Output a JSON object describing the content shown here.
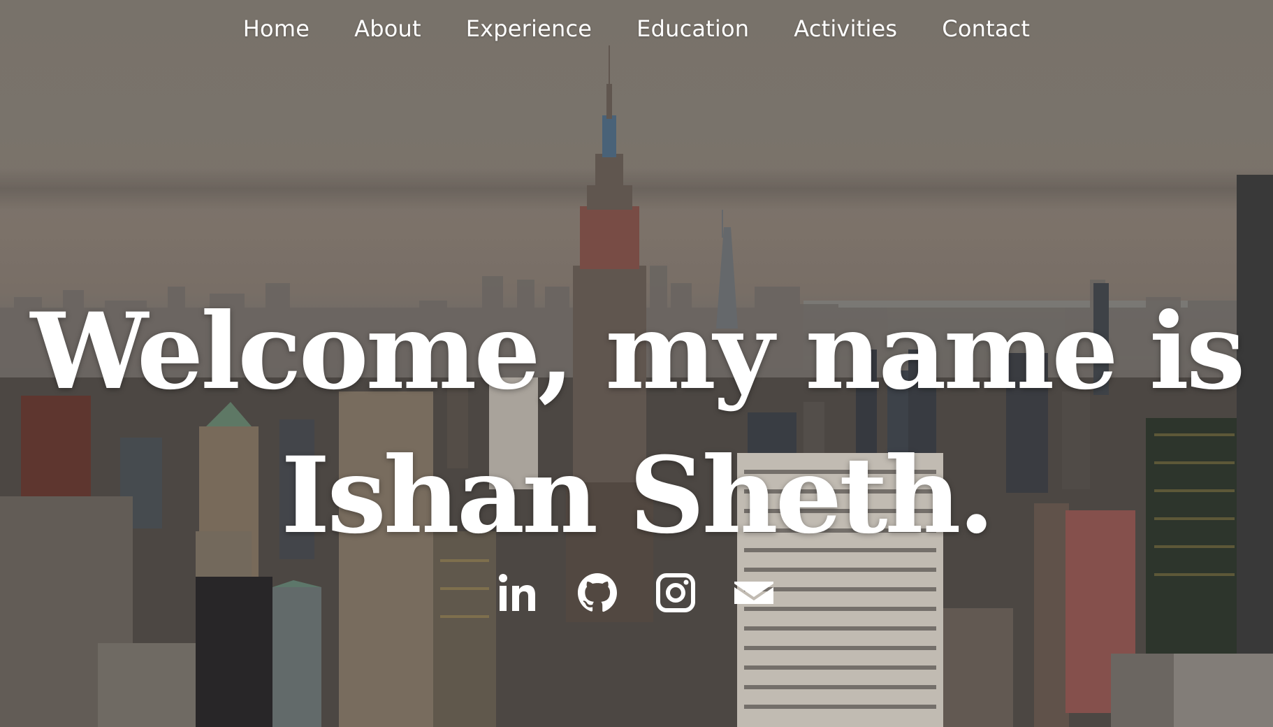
{
  "nav": {
    "items": [
      {
        "label": "Home"
      },
      {
        "label": "About"
      },
      {
        "label": "Experience"
      },
      {
        "label": "Education"
      },
      {
        "label": "Activities"
      },
      {
        "label": "Contact"
      }
    ]
  },
  "hero": {
    "line1": "Welcome, my name is",
    "line2": "Ishan Sheth.",
    "background_image": "city-skyline-photo"
  },
  "social": {
    "icons": [
      "linkedin-icon",
      "github-icon",
      "instagram-icon",
      "email-icon"
    ]
  },
  "colors": {
    "text": "#ffffff",
    "overlay": "#6e6a63"
  }
}
